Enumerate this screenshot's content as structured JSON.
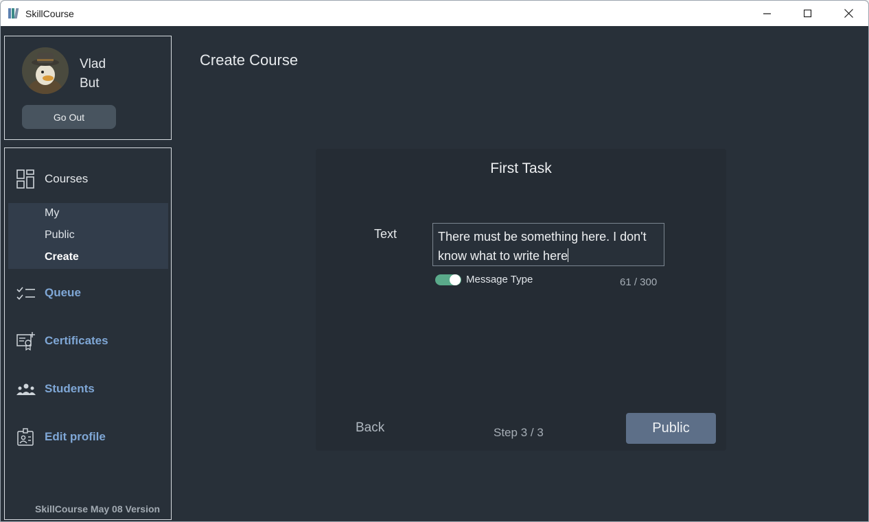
{
  "window": {
    "title": "SkillCourse",
    "controls": {
      "minimize": "minimize-icon",
      "maximize": "maximize-icon",
      "close": "close-icon"
    }
  },
  "profile": {
    "first_name": "Vlad",
    "last_name": "But",
    "go_out_label": "Go Out"
  },
  "nav": {
    "courses_label": "Courses",
    "courses_sub": {
      "my": "My",
      "public": "Public",
      "create": "Create"
    },
    "queue_label": "Queue",
    "certificates_label": "Certificates",
    "students_label": "Students",
    "edit_profile_label": "Edit profile",
    "footer": "SkillCourse  May 08 Version"
  },
  "main": {
    "page_title": "Create Course",
    "card": {
      "title": "First Task",
      "field_label": "Text",
      "text_value": "There must be something here. I don't know what to write here",
      "toggle_label": "Message Type",
      "toggle_on": true,
      "counter": "61 / 300",
      "back_label": "Back",
      "step": "Step 3 / 3",
      "public_label": "Public"
    }
  },
  "colors": {
    "background": "#283039",
    "card": "#252c34",
    "accent_link": "#7fa7d6",
    "toggle_on": "#5aaa8a",
    "primary_button": "#5d6f88"
  }
}
